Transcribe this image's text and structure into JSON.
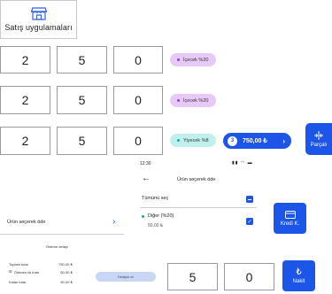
{
  "app_tile": {
    "label": "Satış uygulamaları",
    "icon": "storefront-icon"
  },
  "keypad_rows": [
    {
      "digits": [
        "2",
        "5",
        "0"
      ],
      "pill": "İçecek %20"
    },
    {
      "digits": [
        "2",
        "5",
        "0"
      ],
      "pill": "İçecek %20"
    },
    {
      "digits": [
        "2",
        "5",
        "0"
      ],
      "pill": "Yiyecek %8"
    }
  ],
  "total_button": {
    "count": "3",
    "amount": "750,00 ₺"
  },
  "split_button": {
    "label": "Parçalı",
    "icon": "split-icon"
  },
  "phone": {
    "time": "12:30",
    "title": "Ürün seçerek öde",
    "select_all": "Tümünü seç",
    "item_name": "Diğer (%20)",
    "item_price": "50,00 ₺"
  },
  "card_button": {
    "label": "Kredi K.",
    "icon": "credit-card-icon"
  },
  "cash_button": {
    "label": "Nakit",
    "icon": "lira-icon"
  },
  "pay_by_item": {
    "label": "Ürün seçerek öde"
  },
  "payment_details": {
    "title": "Ödeme detayı",
    "rows": [
      {
        "label": "Toplam tutar",
        "value": "750,00 ₺"
      },
      {
        "label": "Ödenen ilk tutar",
        "value": "60,00 ₺"
      },
      {
        "label": "Kalan tutar",
        "value": "50,00 ₺"
      }
    ]
  },
  "small_pill": {
    "label": "Detaylar ok"
  },
  "bottom_keys": [
    "5",
    "0"
  ],
  "colors": {
    "accent": "#1c56e8",
    "purple": "#e7c9f7",
    "teal": "#bff0ee"
  }
}
